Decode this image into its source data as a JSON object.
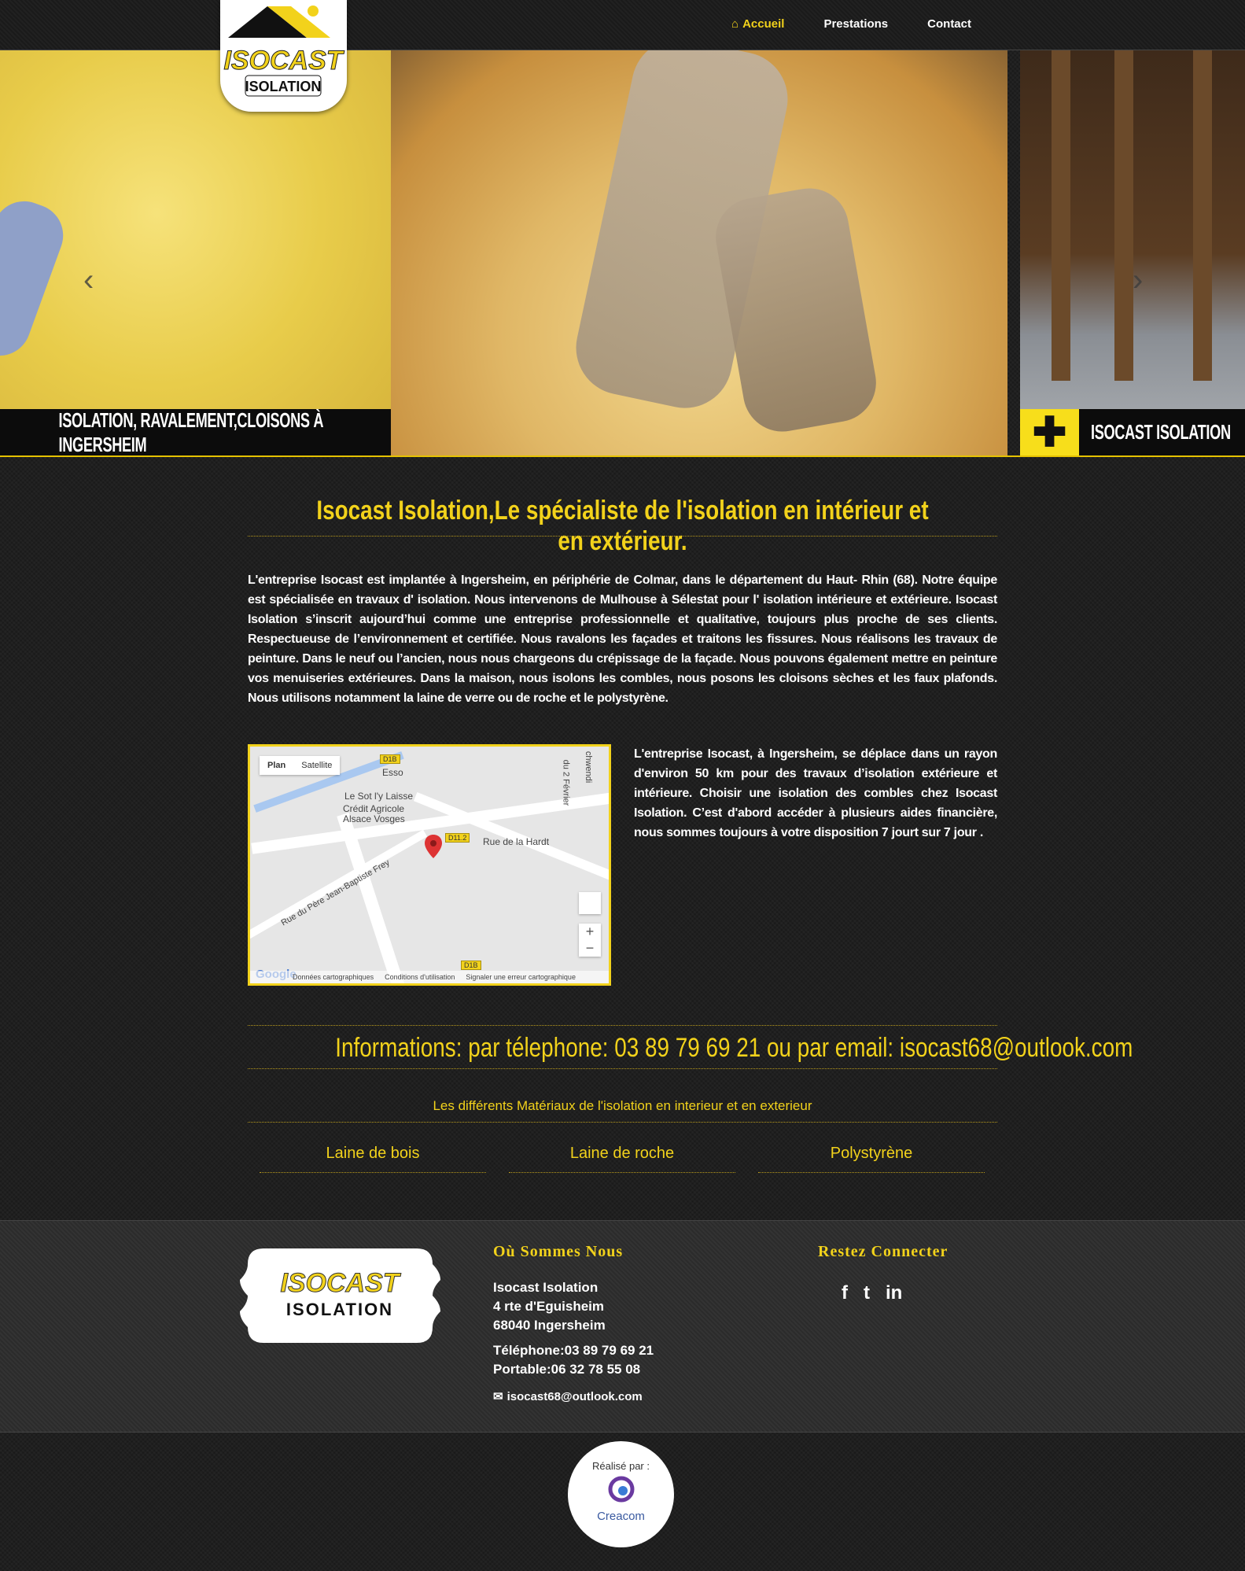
{
  "brand": {
    "logo_text": "ISOCAST",
    "logo_sub": "ISOLATION",
    "colors": {
      "accent": "#f2d21b",
      "background": "#1f1f1f",
      "text": "#ffffff"
    }
  },
  "nav": {
    "items": [
      {
        "label": "Accueil",
        "icon": "home-icon",
        "active": true
      },
      {
        "label": "Prestations",
        "active": false
      },
      {
        "label": "Contact",
        "active": false
      }
    ]
  },
  "hero": {
    "left_caption": "ISOLATION, RAVALEMENT,CLOISONS À INGERSHEIM",
    "right_caption": "ISOCAST ISOLATION",
    "plus_symbol": "✚",
    "prev_icon": "chevron-left-icon",
    "next_icon": "chevron-right-icon"
  },
  "main": {
    "title": "Isocast Isolation,Le spécialiste de l'isolation en intérieur et en extérieur.",
    "intro": "L'entreprise Isocast est implantée à Ingersheim, en périphérie de Colmar, dans le département du Haut- Rhin (68). Notre équipe est spécialisée en travaux d' isolation. Nous intervenons de Mulhouse à Sélestat pour l' isolation intérieure et extérieure. Isocast Isolation s’inscrit aujourd’hui comme une entreprise professionnelle et qualitative, toujours plus proche de ses clients. Respectueuse de l’environnement et certifiée. Nous ravalons les façades et traitons les fissures. Nous réalisons les travaux de peinture. Dans le neuf ou l’ancien, nous nous chargeons du crépissage de la façade. Nous pouvons également mettre en peinture vos menuiseries extérieures. Dans la maison, nous isolons les combles, nous posons les cloisons sèches et les faux plafonds. Nous utilisons notamment la laine de verre ou de roche et le polystyrène.",
    "side_text": "L'entreprise Isocast, à Ingersheim, se déplace dans un rayon d'environ 50 km pour des travaux d’isolation extérieure et intérieure. Choisir une isolation des combles chez Isocast Isolation. C’est d'abord accéder à plusieurs aides financière, nous sommes toujours à votre disposition 7 jourt sur 7 jour .",
    "info": "Informations: par télephone: 03 89 79 69 21 ou par email: isocast68@outlook.com",
    "materials_title": "Les différents Matériaux de  l'isolation en interieur et en exterieur",
    "materials": [
      "Laine de bois",
      "Laine de roche",
      "Polystyrène"
    ]
  },
  "map": {
    "tabs": [
      "Plan",
      "Satellite"
    ],
    "labels": {
      "esso": "Esso",
      "sot": "Le Sot l'y Laisse",
      "credit1": "Crédit Agricole",
      "credit2": "Alsace Vosges",
      "hardt": "Rue de la Hardt",
      "frey": "Rue du Père Jean-Baptiste Frey",
      "fevrier": "du 2 Février",
      "schwendi": "chwendi",
      "d1b_top": "D1B",
      "d112": "D11.2",
      "d1b_bottom": "D1B"
    },
    "zoom_in": "+",
    "zoom_out": "−",
    "google": "Google",
    "footer": [
      "Données cartographiques",
      "Conditions d'utilisation",
      "Signaler une erreur cartographique"
    ]
  },
  "footer": {
    "location_heading": "Où Sommes Nous",
    "social_heading": "Restez Connecter",
    "address": [
      "Isocast Isolation",
      "4 rte d'Eguisheim",
      "68040 Ingersheim"
    ],
    "phone": "Téléphone:03 89 79 69 21",
    "mobile": "Portable:06 32 78 55 08",
    "email": "isocast68@outlook.com",
    "social_icons": [
      "facebook-icon",
      "twitter-icon",
      "linkedin-icon"
    ],
    "social_glyphs": [
      "f",
      "t",
      "in"
    ],
    "credit_label": "Réalisé par :",
    "credit_name": "Creacom"
  }
}
